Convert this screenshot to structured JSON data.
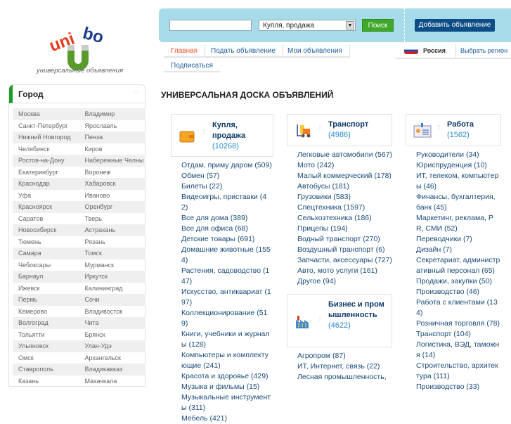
{
  "logo": {
    "text": "unibo",
    "tagline": "универсальные объявления"
  },
  "search": {
    "value": "",
    "placeholder": "",
    "category": "Купля, продажа",
    "button": "Поиск",
    "add_button": "Добавить объявление"
  },
  "nav": [
    {
      "label": "Главная",
      "active": true
    },
    {
      "label": "Подать объявление"
    },
    {
      "label": "Мои объявления"
    },
    {
      "label": "Подписаться"
    }
  ],
  "region": {
    "current": "Россия",
    "choose": "Выбрать регион"
  },
  "sidebar": {
    "title": "Город",
    "cities": [
      [
        "Москва",
        "Владимир"
      ],
      [
        "Санкт-Петербург",
        "Ярославль"
      ],
      [
        "Нижний Новгород",
        "Пенза"
      ],
      [
        "Челябинск",
        "Киров"
      ],
      [
        "Ростов-на-Дону",
        "Набережные Челны"
      ],
      [
        "Екатеринбург",
        "Воронеж"
      ],
      [
        "Краснодар",
        "Хабаровск"
      ],
      [
        "Уфа",
        "Иваново"
      ],
      [
        "Красноярск",
        "Оренбург"
      ],
      [
        "Саратов",
        "Тверь"
      ],
      [
        "Новосибирск",
        "Астрахань"
      ],
      [
        "Тюмень",
        "Рязань"
      ],
      [
        "Самара",
        "Томск"
      ],
      [
        "Чебоксары",
        "Мурманск"
      ],
      [
        "Барнаул",
        "Иркутск"
      ],
      [
        "Ижевск",
        "Калининград"
      ],
      [
        "Пермь",
        "Сочи"
      ],
      [
        "Кемерово",
        "Владивосток"
      ],
      [
        "Волгоград",
        "Чита"
      ],
      [
        "Тольятти",
        "Брянск"
      ],
      [
        "Ульяновск",
        "Улан-Удэ"
      ],
      [
        "Омск",
        "Архангельск"
      ],
      [
        "Ставрополь",
        "Владикавказ"
      ],
      [
        "Казань",
        "Махачкала"
      ]
    ]
  },
  "main": {
    "title": "УНИВЕРСАЛЬНАЯ ДОСКА ОБЪЯВЛЕНИЙ",
    "categories": [
      {
        "name": "Купля, продажа",
        "count": "(10268)",
        "items": [
          "Отдам, приму даром (509)",
          "Обмен (57)",
          "Билеты (22)",
          "Видеоигры, приставки (42)",
          "Все для дома (389)",
          "Все для офиса (68)",
          "Детские товары (691)",
          "Домашние животные (1554)",
          "Растения, садоводство (147)",
          "Искусство, антиквариат (197)",
          "Коллекционирование (519)",
          "Книги, учебники и журналы (128)",
          "Компьютеры и комплектующие (241)",
          "Красота и здоровье (429)",
          "Музыка и фильмы (15)",
          "Музыкальные инструменты (311)",
          "Мебель (421)"
        ]
      },
      {
        "name": "Транспорт",
        "count": "(4986)",
        "items": [
          "Легковые автомобили (567)",
          "Мото (242)",
          "Малый коммерческий (178)",
          "Автобусы (181)",
          "Грузовики (583)",
          "Спецтехника (1597)",
          "Сельхозтехника (186)",
          "Прицепы (194)",
          "Водный транспорт (270)",
          "Воздушный транспорт (6)",
          "Запчасти, аксессуары (727)",
          "Авто, мото услуги (161)",
          "Другое (94)"
        ]
      },
      {
        "name": "Работа",
        "count": "(1562)",
        "items": [
          "Руководители (34)",
          "Юриспруденция (10)",
          "ИТ, телеком, компьютеры (46)",
          "Финансы, бухгалтерия, банк (45)",
          "Маркетинг, реклама, PR, СМИ (52)",
          "Переводчики (7)",
          "Дизайн (7)",
          "Секретариат, административный персонал (65)",
          "Продажи, закупки (50)",
          "Производство (46)",
          "Работа с клиентами (134)",
          "Розничная торговля (78)",
          "Транспорт (104)",
          "Логистика, ВЭД, таможня (14)",
          "Строительство, архитектура (111)",
          "Производство (33)"
        ]
      },
      {
        "name": "Бизнес и промышленность",
        "count": "(4622)",
        "items": [
          "Агропром (87)",
          "ИТ, Интернет, связь (22)",
          "Лесная промышленность,"
        ]
      }
    ]
  },
  "colors": {
    "accent_green": "#3fa82a",
    "brand_blue": "#0d4d86",
    "bar": "#a8dbe9",
    "active_nav": "#e8502a"
  }
}
